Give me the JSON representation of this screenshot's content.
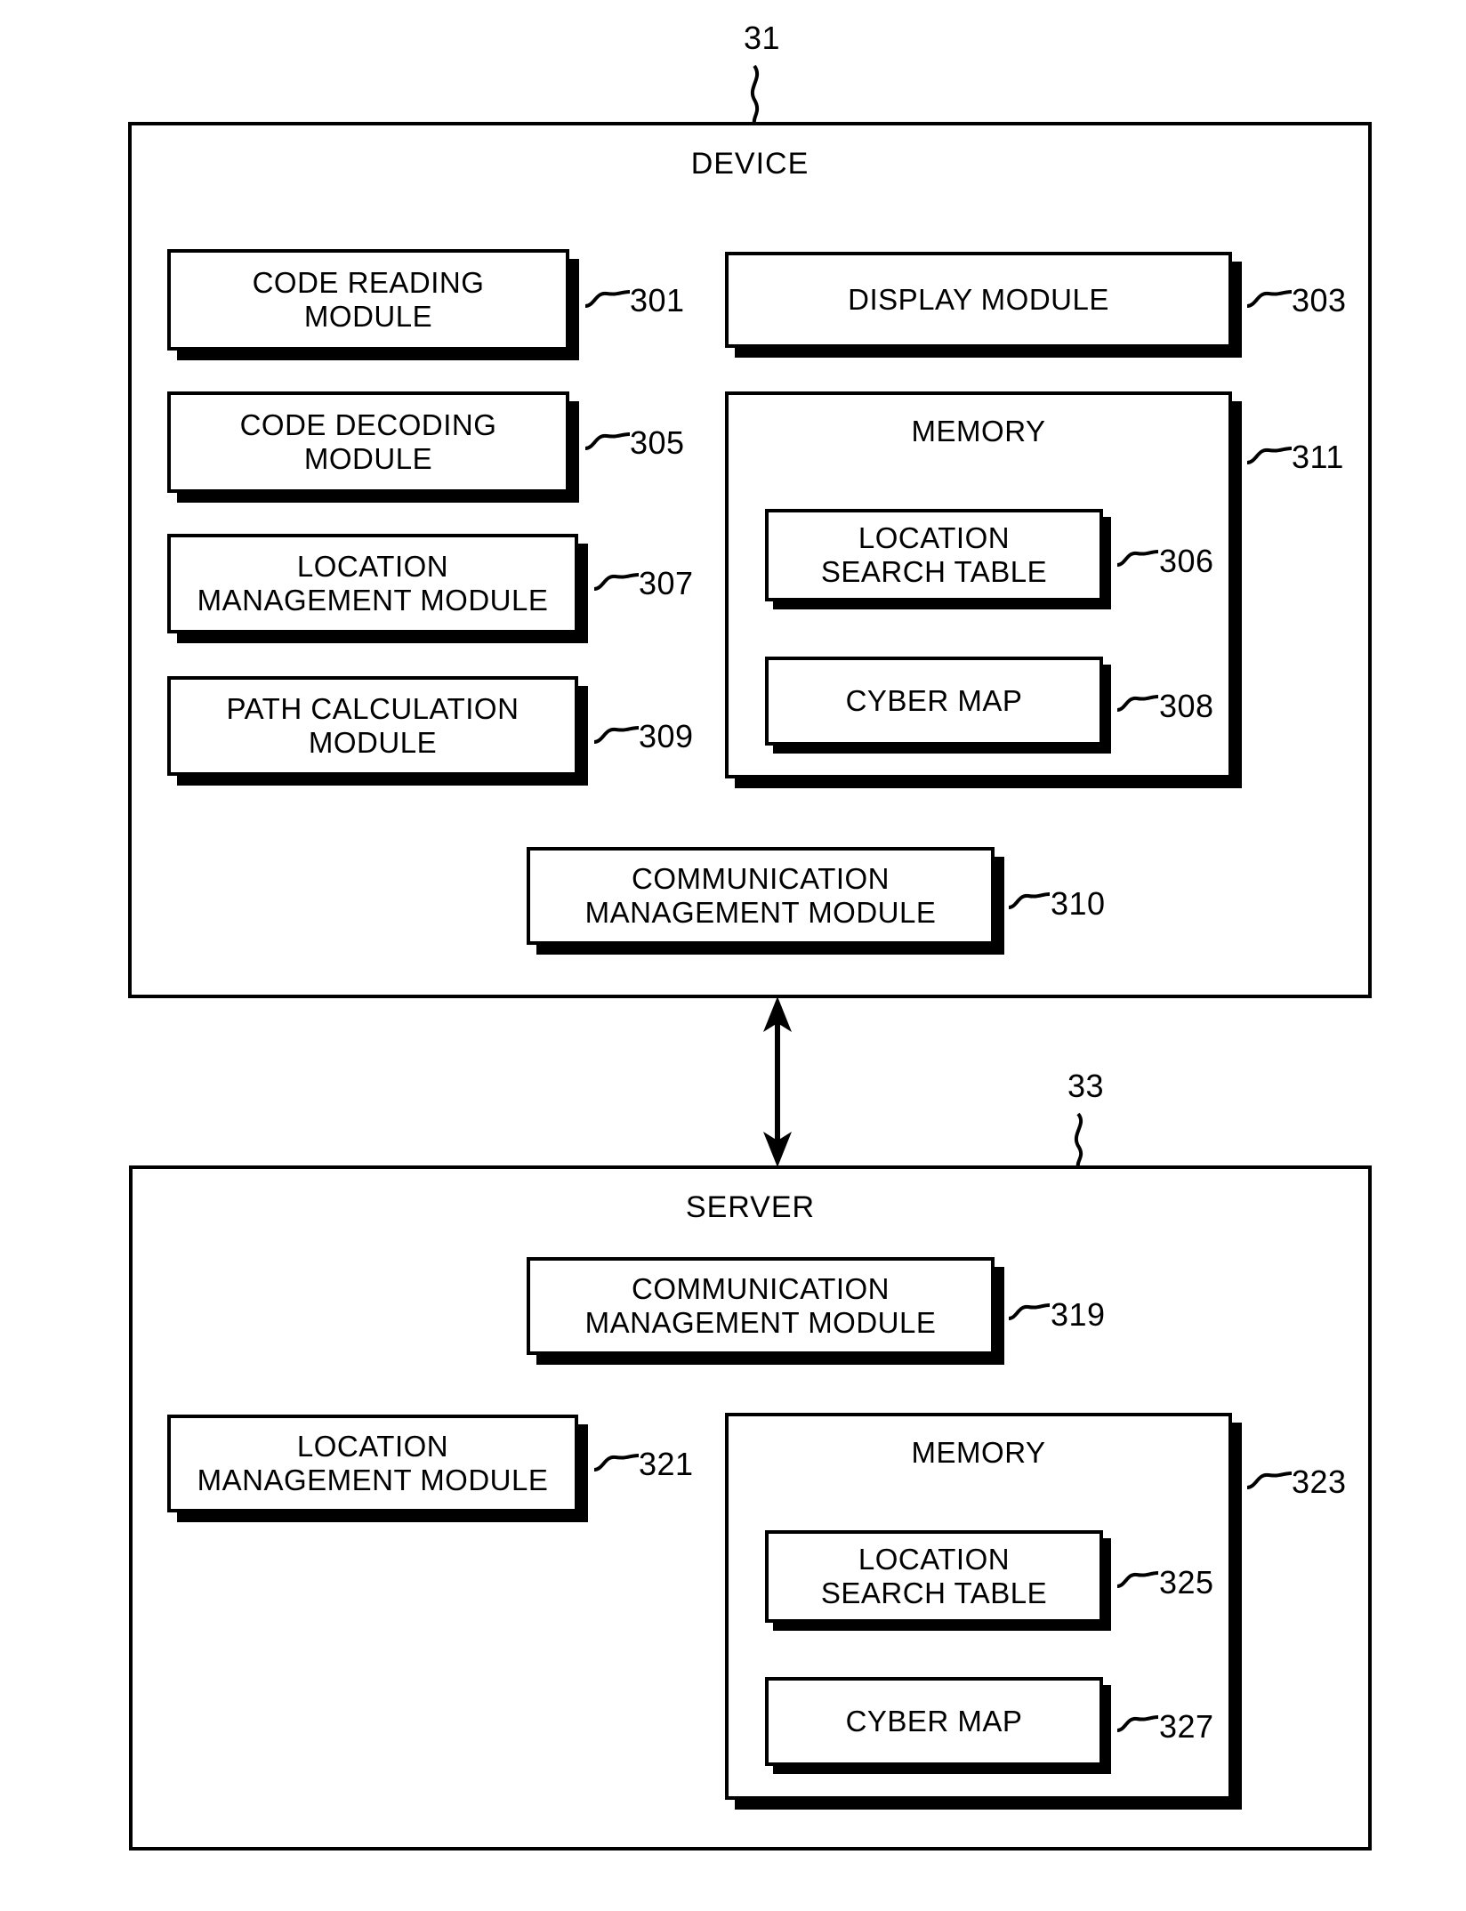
{
  "figure": {
    "device": {
      "title": "DEVICE",
      "ref": "31",
      "modules": [
        {
          "label": "CODE READING\nMODULE",
          "ref": "301"
        },
        {
          "label": "CODE DECODING\nMODULE",
          "ref": "305"
        },
        {
          "label": "LOCATION\nMANAGEMENT MODULE",
          "ref": "307"
        },
        {
          "label": "PATH CALCULATION\nMODULE",
          "ref": "309"
        },
        {
          "label": "DISPLAY MODULE",
          "ref": "303"
        },
        {
          "label": "COMMUNICATION\nMANAGEMENT MODULE",
          "ref": "310"
        }
      ],
      "memory": {
        "title": "MEMORY",
        "ref": "311",
        "children": [
          {
            "label": "LOCATION\nSEARCH TABLE",
            "ref": "306"
          },
          {
            "label": "CYBER MAP",
            "ref": "308"
          }
        ]
      }
    },
    "server": {
      "title": "SERVER",
      "ref": "33",
      "modules": [
        {
          "label": "COMMUNICATION\nMANAGEMENT MODULE",
          "ref": "319"
        },
        {
          "label": "LOCATION\nMANAGEMENT MODULE",
          "ref": "321"
        }
      ],
      "memory": {
        "title": "MEMORY",
        "ref": "323",
        "children": [
          {
            "label": "LOCATION\nSEARCH TABLE",
            "ref": "325"
          },
          {
            "label": "CYBER MAP",
            "ref": "327"
          }
        ]
      }
    },
    "link": {
      "name": "bidirectional-link",
      "direction": "both"
    },
    "colors": {
      "ink": "#000000",
      "paper": "#ffffff"
    }
  }
}
